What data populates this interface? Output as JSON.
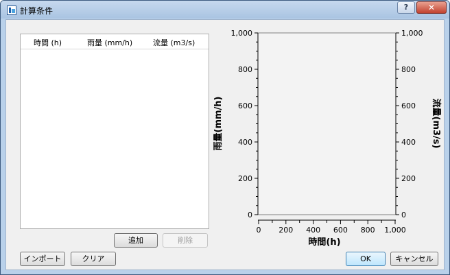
{
  "window": {
    "title": "計算条件",
    "help_label": "?",
    "close_label": "✕"
  },
  "table": {
    "columns": [
      "時間 (h)",
      "雨量 (mm/h)",
      "流量 (m3/s)"
    ],
    "rows": []
  },
  "buttons": {
    "add": "追加",
    "delete": "削除",
    "import": "インポート",
    "clear": "クリア",
    "ok": "OK",
    "cancel": "キャンセル"
  },
  "chart_data": {
    "type": "line",
    "xlabel": "時間(h)",
    "ylabel_left": "雨量(mm/h)",
    "ylabel_right": "流量(m3/s)",
    "xlim": [
      0,
      1000
    ],
    "ylim_left": [
      0,
      1000
    ],
    "ylim_right": [
      0,
      1000
    ],
    "x_ticks": [
      "0",
      "200",
      "400",
      "600",
      "800",
      "1,000"
    ],
    "y_ticks_left": [
      "0",
      "200",
      "400",
      "600",
      "800",
      "1,000"
    ],
    "y_ticks_right": [
      "0",
      "200",
      "400",
      "600",
      "800",
      "1,000"
    ],
    "series": []
  }
}
